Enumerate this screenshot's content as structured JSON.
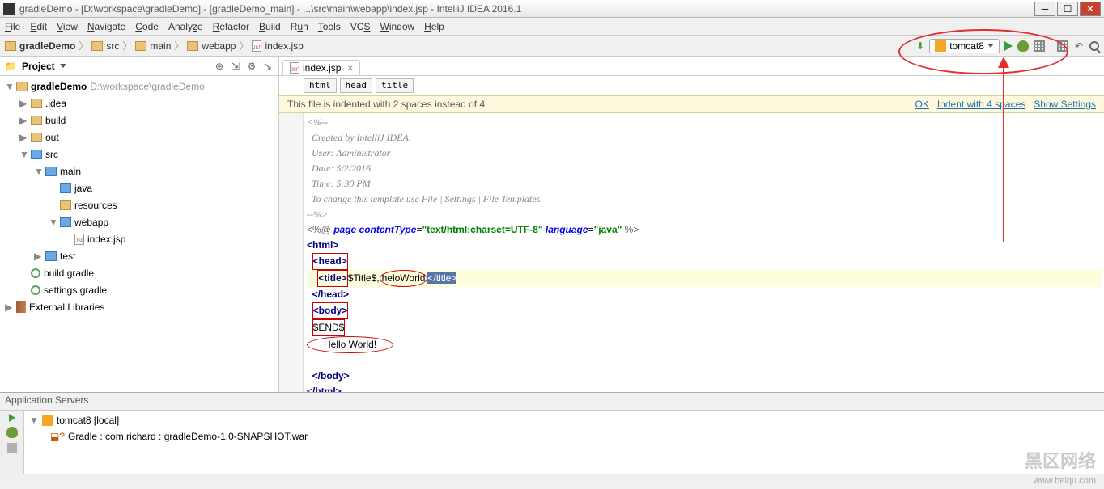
{
  "window": {
    "title": "gradleDemo - [D:\\workspace\\gradleDemo] - [gradleDemo_main] - ...\\src\\main\\webapp\\index.jsp - IntelliJ IDEA 2016.1"
  },
  "menu": [
    "File",
    "Edit",
    "View",
    "Navigate",
    "Code",
    "Analyze",
    "Refactor",
    "Build",
    "Run",
    "Tools",
    "VCS",
    "Window",
    "Help"
  ],
  "breadcrumbs": [
    {
      "icon": "folder",
      "label": "gradleDemo",
      "bold": true
    },
    {
      "icon": "folder",
      "label": "src"
    },
    {
      "icon": "folder",
      "label": "main"
    },
    {
      "icon": "folder",
      "label": "webapp"
    },
    {
      "icon": "jsp",
      "label": "index.jsp"
    }
  ],
  "run_config": {
    "label": "tomcat8"
  },
  "project": {
    "title": "Project",
    "tree": [
      {
        "d": 0,
        "a": "▼",
        "i": "folder",
        "t": "gradleDemo",
        "suffix": " D:\\workspace\\gradleDemo",
        "bold": true
      },
      {
        "d": 1,
        "a": "▶",
        "i": "folder",
        "t": ".idea"
      },
      {
        "d": 1,
        "a": "▶",
        "i": "folder",
        "t": "build"
      },
      {
        "d": 1,
        "a": "▶",
        "i": "folder",
        "t": "out"
      },
      {
        "d": 1,
        "a": "▼",
        "i": "blue",
        "t": "src"
      },
      {
        "d": 2,
        "a": "▼",
        "i": "blue",
        "t": "main"
      },
      {
        "d": 3,
        "a": "",
        "i": "blue",
        "t": "java"
      },
      {
        "d": 3,
        "a": "",
        "i": "folder",
        "t": "resources"
      },
      {
        "d": 3,
        "a": "▼",
        "i": "blue",
        "t": "webapp"
      },
      {
        "d": 4,
        "a": "",
        "i": "jsp",
        "t": "index.jsp"
      },
      {
        "d": 2,
        "a": "▶",
        "i": "blue",
        "t": "test"
      },
      {
        "d": 1,
        "a": "",
        "i": "green",
        "t": "build.gradle"
      },
      {
        "d": 1,
        "a": "",
        "i": "green",
        "t": "settings.gradle"
      },
      {
        "d": 0,
        "a": "▶",
        "i": "lib",
        "t": "External Libraries"
      }
    ]
  },
  "editor": {
    "tab": {
      "label": "index.jsp"
    },
    "crumbs": [
      "html",
      "head",
      "title"
    ],
    "indent_msg": "This file is indented with 2 spaces instead of 4",
    "indent_links": {
      "ok": "OK",
      "indent": "Indent with 4 spaces",
      "show": "Show Settings"
    },
    "code": {
      "c1": "<%--",
      "c2": "  Created by IntelliJ IDEA.",
      "c3": "  User: Administrator",
      "c4": "  Date: 5/2/2016",
      "c5": "  Time: 5:30 PM",
      "c6": "  To change this template use File | Settings | File Templates.",
      "c7": "--%>",
      "page": "<%@ ",
      "page_kw": "page ",
      "ct_attr": "contentType",
      "eq": "=",
      "ct_val": "\"text/html;charset=UTF-8\"",
      "lang_attr": " language",
      "lang_val": "\"java\"",
      "page_end": " %>",
      "html_o": "<html>",
      "head_o": "<head>",
      "title_o": "<title>",
      "title_txt": "$Title$,",
      "title_hello": "heloWorld",
      "title_c": "</title>",
      "head_c": "</head>",
      "body_o": "<body>",
      "end": "$END$",
      "hello": "Hello World!",
      "body_c": "</body>",
      "html_c": "</html>"
    }
  },
  "app_servers": {
    "title": "Application Servers",
    "node1": "tomcat8 [local]",
    "node2": "Gradle : com.richard : gradleDemo-1.0-SNAPSHOT.war"
  },
  "watermark": {
    "text": "黑区网络",
    "url": "www.heiqu.com"
  }
}
